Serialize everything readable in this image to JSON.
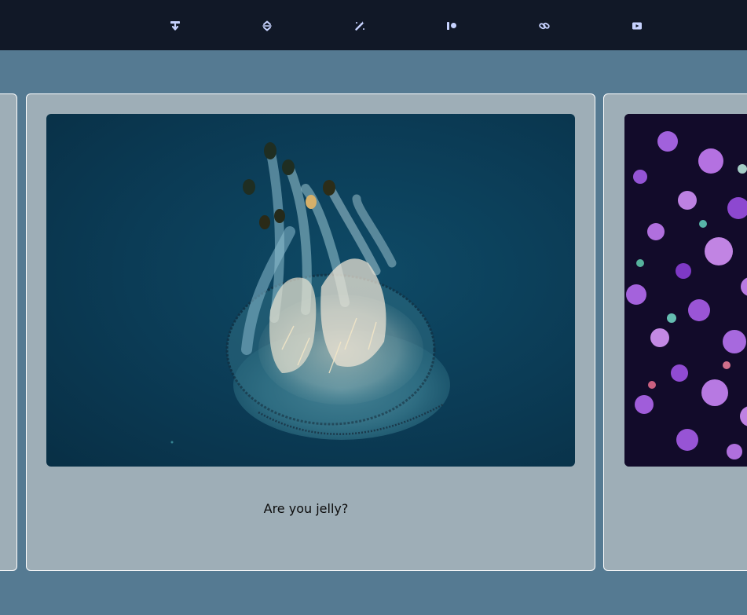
{
  "toolbar": {
    "buttons": [
      {
        "name": "download-icon"
      },
      {
        "name": "sort-icon"
      },
      {
        "name": "magic-wand-icon"
      },
      {
        "name": "patreon-icon"
      },
      {
        "name": "link-icon"
      },
      {
        "name": "video-icon"
      }
    ],
    "icon_color": "#c7d2fe"
  },
  "carousel": {
    "slides": [
      {
        "caption": ""
      },
      {
        "caption": "Are you jelly?"
      },
      {
        "caption": ""
      }
    ],
    "active_index": 1
  },
  "colors": {
    "topbar": "#111827",
    "background": "#557a92",
    "card": "#9eaeb7",
    "card_border": "#ffffff"
  }
}
